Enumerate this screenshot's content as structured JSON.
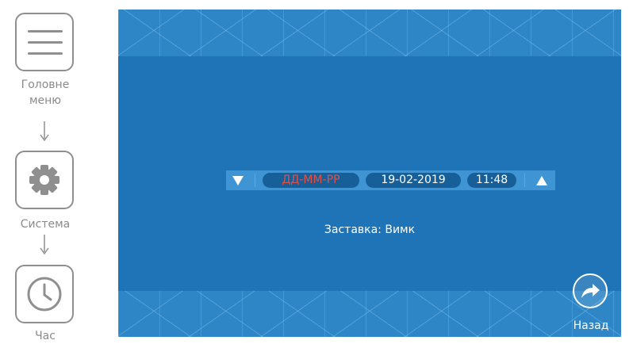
{
  "nav": {
    "items": [
      {
        "label": "Головне меню",
        "icon": "menu-icon"
      },
      {
        "label": "Система",
        "icon": "gear-icon"
      },
      {
        "label": "Час",
        "icon": "clock-icon"
      }
    ]
  },
  "screen": {
    "date_format": "ДД-ММ-РР",
    "date": "19-02-2019",
    "time": "11:48",
    "screensaver": "Заставка: Вимк",
    "back_label": "Назад"
  },
  "colors": {
    "screen_bg": "#1f74b8",
    "band_bg": "#2e86c7",
    "format_text": "#e0504a",
    "nav_border": "#8f8f8f"
  }
}
